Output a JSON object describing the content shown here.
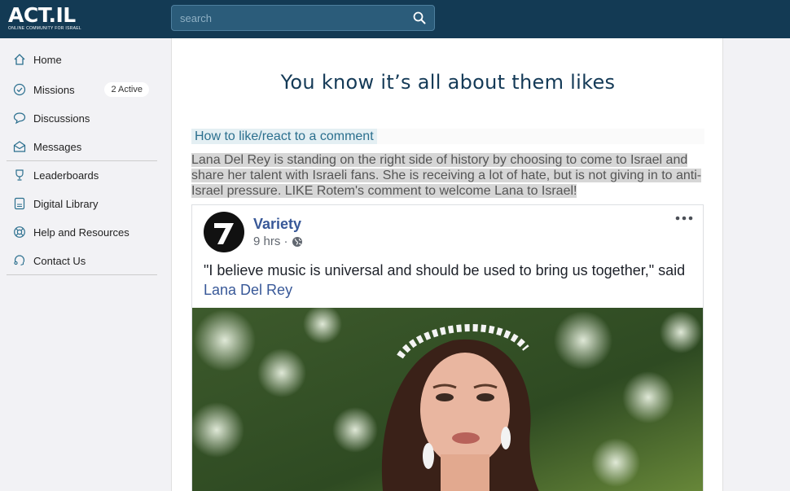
{
  "header": {
    "logo_text": "ACT.IL",
    "logo_tagline": "ONLINE COMMUNITY FOR ISRAEL",
    "search_placeholder": "search"
  },
  "sidebar": {
    "items": [
      {
        "label": "Home",
        "icon": "home-icon"
      },
      {
        "label": "Missions",
        "icon": "check-circle-icon",
        "badge": "2 Active"
      },
      {
        "label": "Discussions",
        "icon": "chat-bubble-icon"
      },
      {
        "label": "Messages",
        "icon": "envelope-icon"
      },
      {
        "label": "Leaderboards",
        "icon": "trophy-icon"
      },
      {
        "label": "Digital Library",
        "icon": "library-icon"
      },
      {
        "label": "Help and Resources",
        "icon": "lifebuoy-icon"
      },
      {
        "label": "Contact Us",
        "icon": "contact-icon"
      }
    ]
  },
  "main": {
    "title": "You know it’s all about them likes",
    "guide_link": "How to like/react to a comment",
    "description": "Lana Del Rey is standing on the right side of history by choosing to come to Israel and share her talent with Israeli fans. She is receiving a lot of hate, but is not giving in to anti-Israel pressure. LIKE Rotem's comment to welcome Lana to Israel!",
    "post": {
      "author": "Variety",
      "time": "9 hrs ·",
      "text_prefix": "\"I believe music is universal and should be used to bring us together,\" said ",
      "mention": "Lana Del Rey"
    }
  },
  "colors": {
    "header_bg": "#133a54",
    "accent": "#143a57",
    "link": "#385898"
  }
}
